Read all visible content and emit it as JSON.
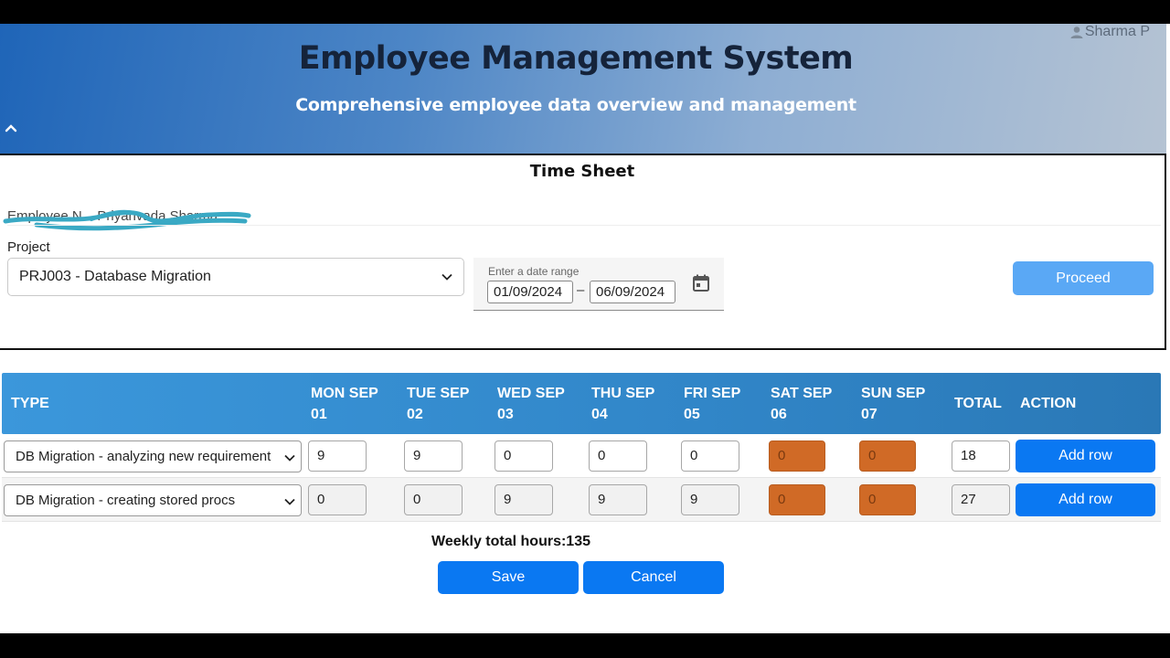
{
  "header": {
    "title": "Employee Management System",
    "subtitle": "Comprehensive employee data overview and management",
    "user_name": "Sharma P"
  },
  "timesheet": {
    "title": "Time Sheet",
    "employee_line": "Employee N... Priyanvada Sharma",
    "project_label": "Project",
    "project_selected": "PRJ003 - Database Migration",
    "date_range_label": "Enter a date range",
    "date_start": "01/09/2024",
    "date_end": "06/09/2024",
    "date_separator": "–",
    "proceed_label": "Proceed"
  },
  "table": {
    "headers": {
      "type": "TYPE",
      "mon": [
        "MON SEP",
        "01"
      ],
      "tue": [
        "TUE SEP",
        "02"
      ],
      "wed": [
        "WED SEP",
        "03"
      ],
      "thu": [
        "THU SEP",
        "04"
      ],
      "fri": [
        "FRI SEP",
        "05"
      ],
      "sat": [
        "SAT SEP",
        "06"
      ],
      "sun": [
        "SUN SEP",
        "07"
      ],
      "total": "TOTAL",
      "action": "ACTION"
    },
    "rows": [
      {
        "type": "DB Migration - analyzing new requirement",
        "mon": "9",
        "tue": "9",
        "wed": "0",
        "thu": "0",
        "fri": "0",
        "sat": "0",
        "sun": "0",
        "total": "18",
        "action_label": "Add row"
      },
      {
        "type": "DB Migration - creating stored procs",
        "mon": "0",
        "tue": "0",
        "wed": "9",
        "thu": "9",
        "fri": "9",
        "sat": "0",
        "sun": "0",
        "total": "27",
        "action_label": "Add row"
      }
    ]
  },
  "footer": {
    "weekly_total": "Weekly total hours:135",
    "save_label": "Save",
    "cancel_label": "Cancel"
  },
  "colors": {
    "primary_button": "#0a78f2",
    "proceed_button": "#5aa8f5",
    "weekend_cell": "#d06a26",
    "table_header": "#3186c8"
  }
}
